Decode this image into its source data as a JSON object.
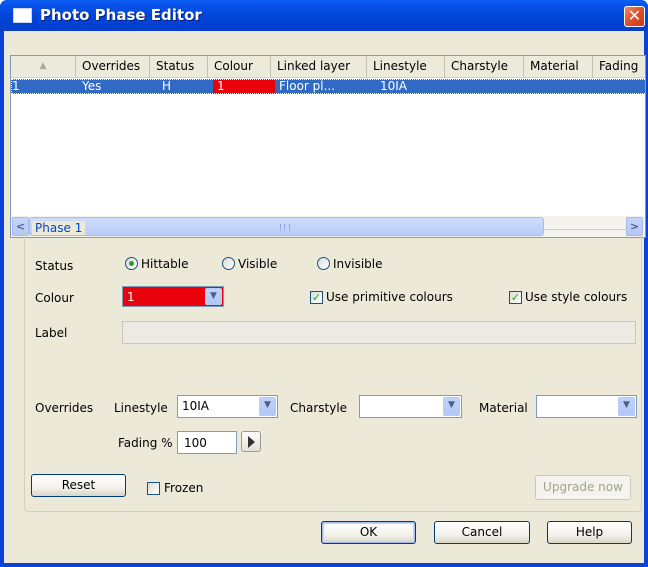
{
  "window": {
    "title": "Photo Phase Editor",
    "close_glyph": "✕"
  },
  "grid": {
    "sort_indicator": "▲",
    "columns": [
      "Overrides",
      "Status",
      "Colour",
      "Linked layer",
      "Linestyle",
      "Charstyle",
      "Material",
      "Fading"
    ],
    "rows": [
      {
        "index": "1",
        "overrides": "Yes",
        "status": "H",
        "colour": "1",
        "colour_swatch": "#e8000b",
        "linked_layer": "Floor pl...",
        "linestyle": "10IA"
      }
    ],
    "scroll_left": "<",
    "scroll_right": ">"
  },
  "phase": {
    "group_title": "Phase 1",
    "status_label": "Status",
    "status_options": [
      {
        "label": "Hittable",
        "selected": true
      },
      {
        "label": "Visible",
        "selected": false
      },
      {
        "label": "Invisible",
        "selected": false
      }
    ],
    "colour_label": "Colour",
    "colour_value": "1",
    "colour_swatch": "#e8000b",
    "use_primitive_colours": {
      "label": "Use primitive colours",
      "checked": true
    },
    "use_style_colours": {
      "label": "Use style colours",
      "checked": true
    },
    "label_label": "Label",
    "label_value": "",
    "overrides_label": "Overrides",
    "linestyle_label": "Linestyle",
    "linestyle_value": "10IA",
    "charstyle_label": "Charstyle",
    "charstyle_value": "",
    "material_label": "Material",
    "material_value": "",
    "fading_label": "Fading %",
    "fading_value": "100",
    "reset_label": "Reset",
    "frozen": {
      "label": "Frozen",
      "checked": false
    },
    "upgrade_label": "Upgrade now"
  },
  "footer": {
    "ok": "OK",
    "cancel": "Cancel",
    "help": "Help"
  }
}
